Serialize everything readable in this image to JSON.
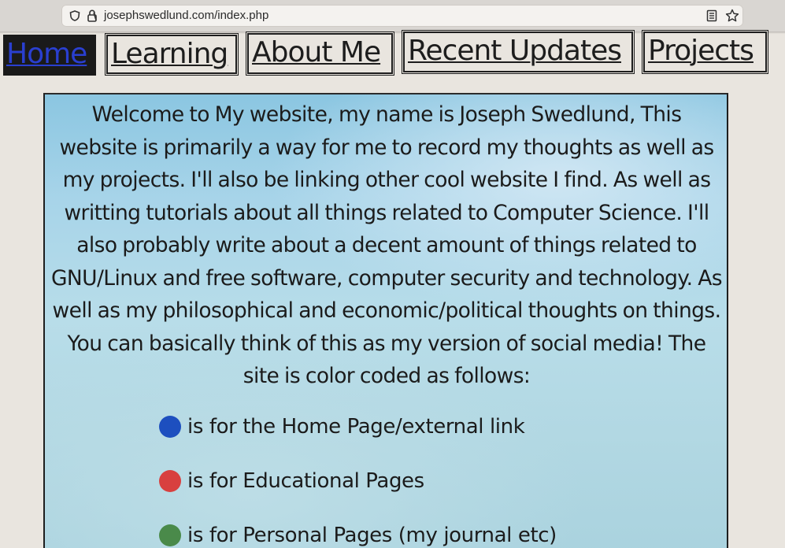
{
  "browser": {
    "url": "josephswedlund.com/index.php",
    "icons": [
      "shield-icon",
      "lock-icon",
      "reader-view-icon",
      "bookmark-star-icon"
    ]
  },
  "nav": {
    "home": "Home",
    "learning": "Learning",
    "about": "About Me",
    "updates": "Recent Updates",
    "projects": "Projects",
    "active": "Home"
  },
  "welcome": {
    "text": "Welcome to My website, my name is Joseph Swedlund, This website is primarily a way for me to record my thoughts as well as my projects. I'll also be linking other cool website I find. As well as writting tutorials about all things related to Computer Science. I'll also probably write about a decent amount of things related to GNU/Linux and free software, computer security and technology. As well as my philosophical and economic/political thoughts on things. You can basically think of this as my version of social media! The site is color coded as follows:"
  },
  "legend": [
    {
      "text": "is for the Home Page/external link",
      "color": "#1d4fbf"
    },
    {
      "text": "is for Educational Pages",
      "color": "#d8403f"
    },
    {
      "text": "is for Personal Pages (my journal etc)",
      "color": "#4a8a4a"
    }
  ],
  "colors": {
    "nav_active_bg": "#1a1a1a",
    "nav_active_text": "#2a3fd0",
    "panel_bg": "#a7d4e9",
    "page_bg": "#e9e5df"
  }
}
